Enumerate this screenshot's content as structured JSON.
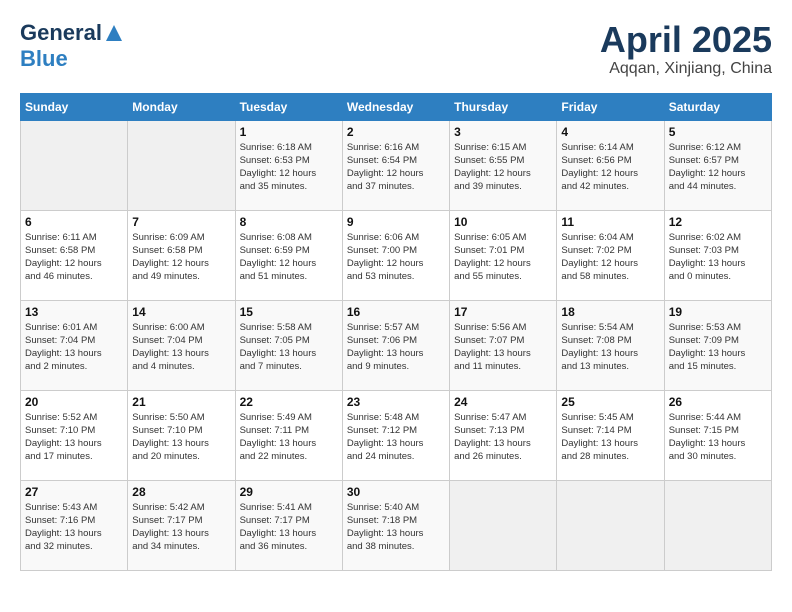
{
  "header": {
    "logo_general": "General",
    "logo_blue": "Blue",
    "month_year": "April 2025",
    "location": "Aqqan, Xinjiang, China"
  },
  "weekdays": [
    "Sunday",
    "Monday",
    "Tuesday",
    "Wednesday",
    "Thursday",
    "Friday",
    "Saturday"
  ],
  "weeks": [
    [
      {
        "day": "",
        "info": ""
      },
      {
        "day": "",
        "info": ""
      },
      {
        "day": "1",
        "info": "Sunrise: 6:18 AM\nSunset: 6:53 PM\nDaylight: 12 hours\nand 35 minutes."
      },
      {
        "day": "2",
        "info": "Sunrise: 6:16 AM\nSunset: 6:54 PM\nDaylight: 12 hours\nand 37 minutes."
      },
      {
        "day": "3",
        "info": "Sunrise: 6:15 AM\nSunset: 6:55 PM\nDaylight: 12 hours\nand 39 minutes."
      },
      {
        "day": "4",
        "info": "Sunrise: 6:14 AM\nSunset: 6:56 PM\nDaylight: 12 hours\nand 42 minutes."
      },
      {
        "day": "5",
        "info": "Sunrise: 6:12 AM\nSunset: 6:57 PM\nDaylight: 12 hours\nand 44 minutes."
      }
    ],
    [
      {
        "day": "6",
        "info": "Sunrise: 6:11 AM\nSunset: 6:58 PM\nDaylight: 12 hours\nand 46 minutes."
      },
      {
        "day": "7",
        "info": "Sunrise: 6:09 AM\nSunset: 6:58 PM\nDaylight: 12 hours\nand 49 minutes."
      },
      {
        "day": "8",
        "info": "Sunrise: 6:08 AM\nSunset: 6:59 PM\nDaylight: 12 hours\nand 51 minutes."
      },
      {
        "day": "9",
        "info": "Sunrise: 6:06 AM\nSunset: 7:00 PM\nDaylight: 12 hours\nand 53 minutes."
      },
      {
        "day": "10",
        "info": "Sunrise: 6:05 AM\nSunset: 7:01 PM\nDaylight: 12 hours\nand 55 minutes."
      },
      {
        "day": "11",
        "info": "Sunrise: 6:04 AM\nSunset: 7:02 PM\nDaylight: 12 hours\nand 58 minutes."
      },
      {
        "day": "12",
        "info": "Sunrise: 6:02 AM\nSunset: 7:03 PM\nDaylight: 13 hours\nand 0 minutes."
      }
    ],
    [
      {
        "day": "13",
        "info": "Sunrise: 6:01 AM\nSunset: 7:04 PM\nDaylight: 13 hours\nand 2 minutes."
      },
      {
        "day": "14",
        "info": "Sunrise: 6:00 AM\nSunset: 7:04 PM\nDaylight: 13 hours\nand 4 minutes."
      },
      {
        "day": "15",
        "info": "Sunrise: 5:58 AM\nSunset: 7:05 PM\nDaylight: 13 hours\nand 7 minutes."
      },
      {
        "day": "16",
        "info": "Sunrise: 5:57 AM\nSunset: 7:06 PM\nDaylight: 13 hours\nand 9 minutes."
      },
      {
        "day": "17",
        "info": "Sunrise: 5:56 AM\nSunset: 7:07 PM\nDaylight: 13 hours\nand 11 minutes."
      },
      {
        "day": "18",
        "info": "Sunrise: 5:54 AM\nSunset: 7:08 PM\nDaylight: 13 hours\nand 13 minutes."
      },
      {
        "day": "19",
        "info": "Sunrise: 5:53 AM\nSunset: 7:09 PM\nDaylight: 13 hours\nand 15 minutes."
      }
    ],
    [
      {
        "day": "20",
        "info": "Sunrise: 5:52 AM\nSunset: 7:10 PM\nDaylight: 13 hours\nand 17 minutes."
      },
      {
        "day": "21",
        "info": "Sunrise: 5:50 AM\nSunset: 7:10 PM\nDaylight: 13 hours\nand 20 minutes."
      },
      {
        "day": "22",
        "info": "Sunrise: 5:49 AM\nSunset: 7:11 PM\nDaylight: 13 hours\nand 22 minutes."
      },
      {
        "day": "23",
        "info": "Sunrise: 5:48 AM\nSunset: 7:12 PM\nDaylight: 13 hours\nand 24 minutes."
      },
      {
        "day": "24",
        "info": "Sunrise: 5:47 AM\nSunset: 7:13 PM\nDaylight: 13 hours\nand 26 minutes."
      },
      {
        "day": "25",
        "info": "Sunrise: 5:45 AM\nSunset: 7:14 PM\nDaylight: 13 hours\nand 28 minutes."
      },
      {
        "day": "26",
        "info": "Sunrise: 5:44 AM\nSunset: 7:15 PM\nDaylight: 13 hours\nand 30 minutes."
      }
    ],
    [
      {
        "day": "27",
        "info": "Sunrise: 5:43 AM\nSunset: 7:16 PM\nDaylight: 13 hours\nand 32 minutes."
      },
      {
        "day": "28",
        "info": "Sunrise: 5:42 AM\nSunset: 7:17 PM\nDaylight: 13 hours\nand 34 minutes."
      },
      {
        "day": "29",
        "info": "Sunrise: 5:41 AM\nSunset: 7:17 PM\nDaylight: 13 hours\nand 36 minutes."
      },
      {
        "day": "30",
        "info": "Sunrise: 5:40 AM\nSunset: 7:18 PM\nDaylight: 13 hours\nand 38 minutes."
      },
      {
        "day": "",
        "info": ""
      },
      {
        "day": "",
        "info": ""
      },
      {
        "day": "",
        "info": ""
      }
    ]
  ]
}
